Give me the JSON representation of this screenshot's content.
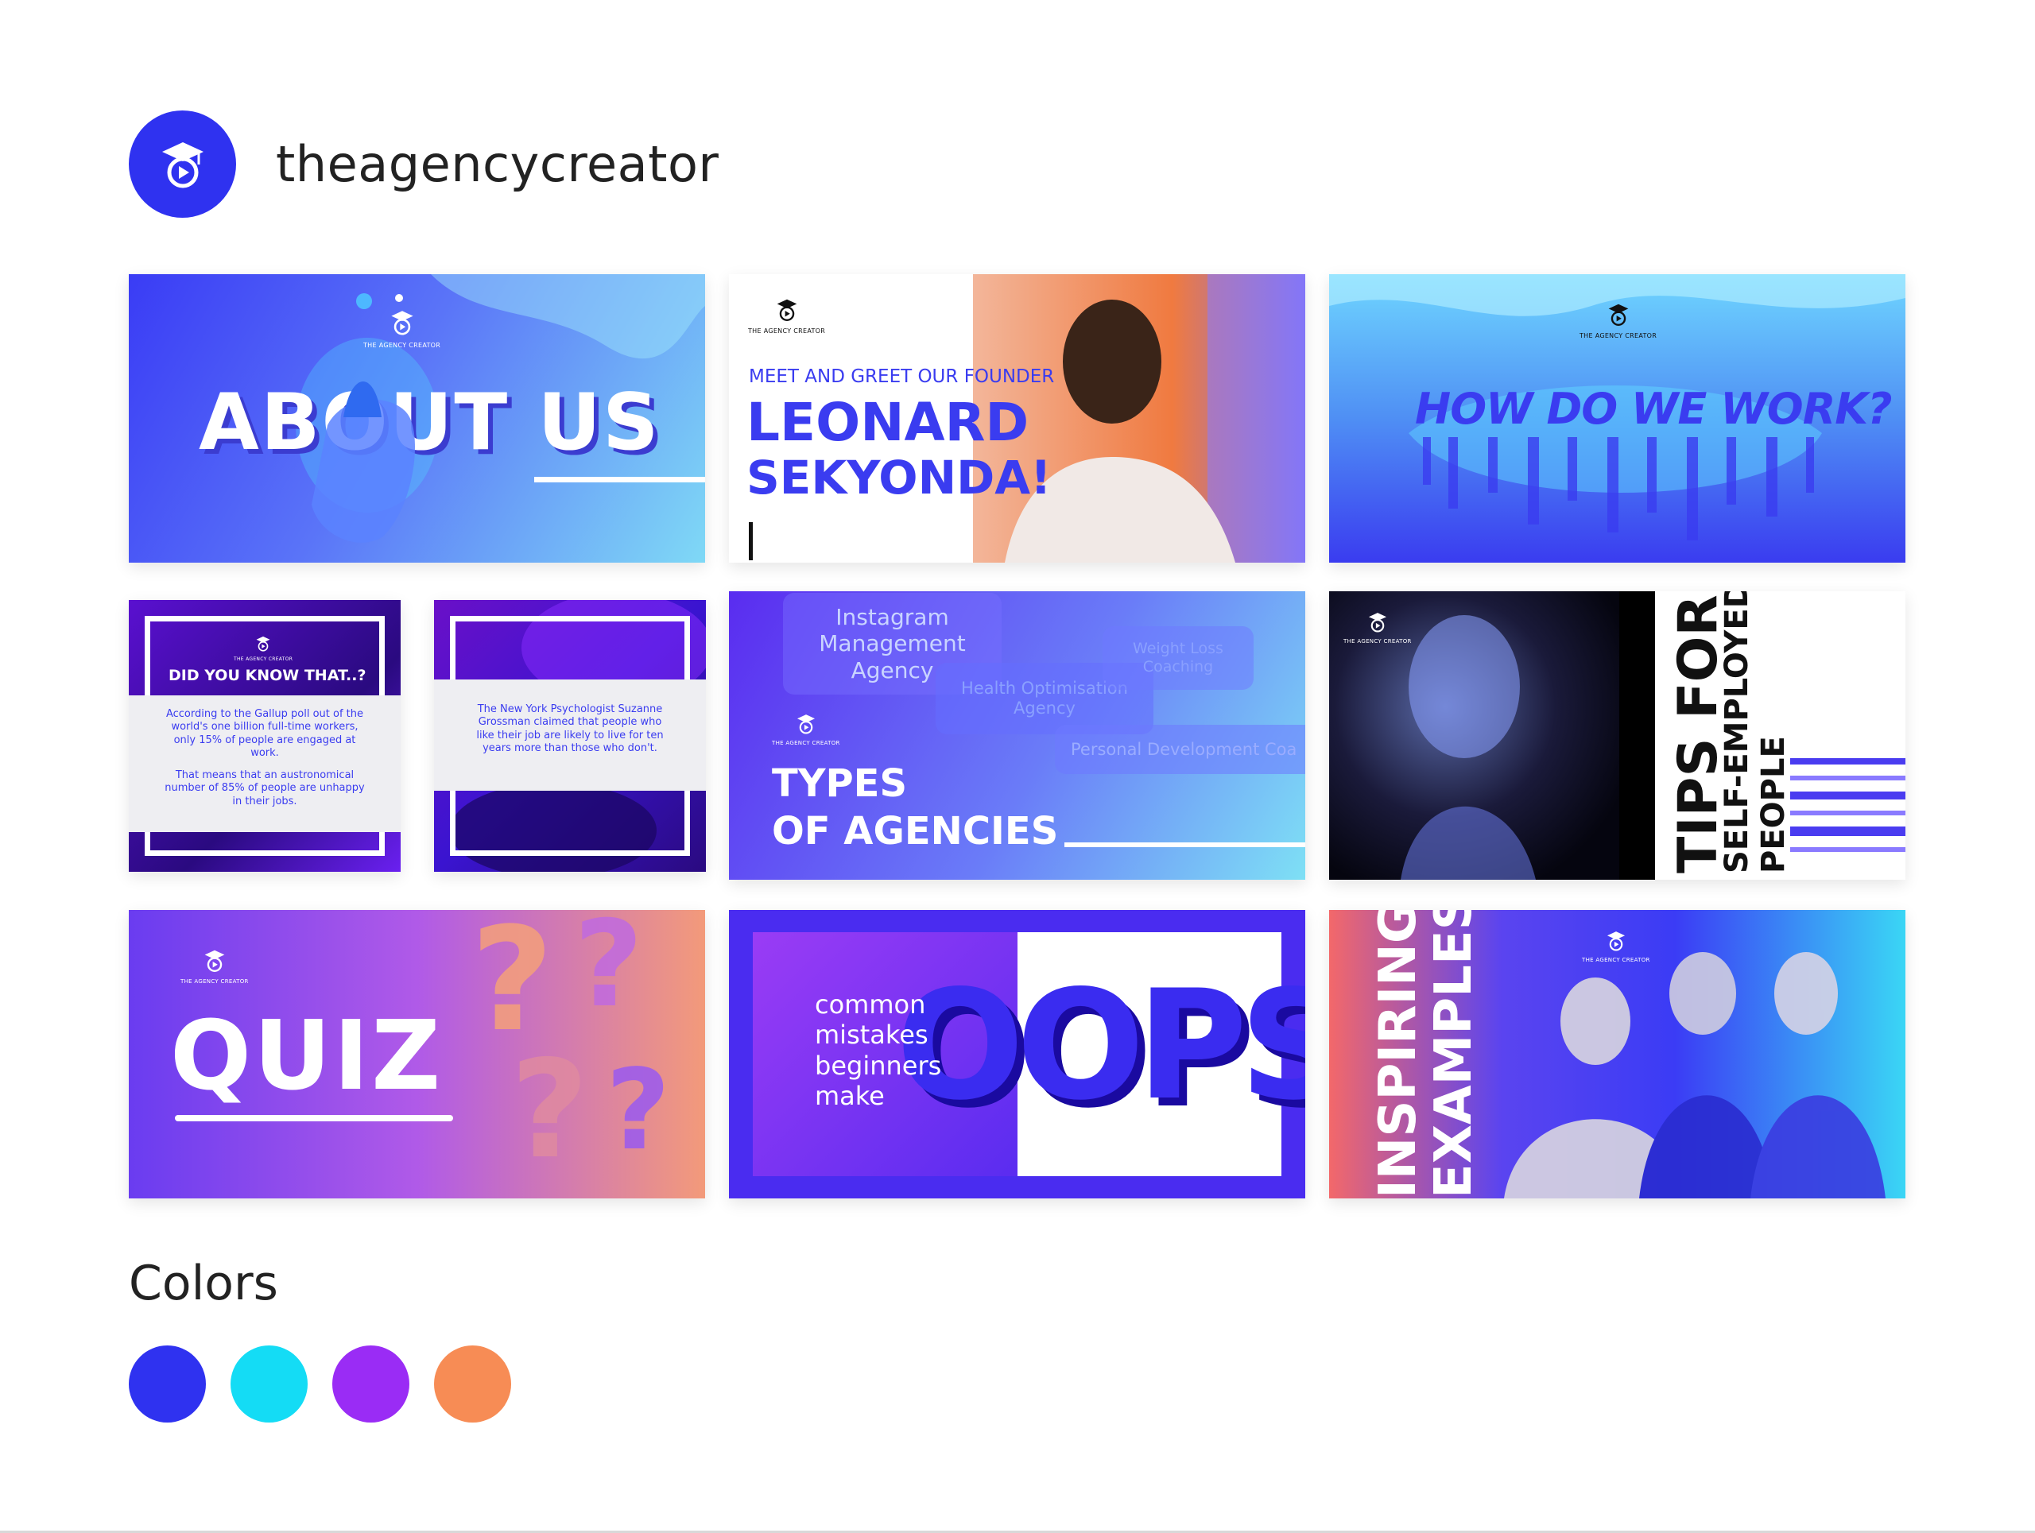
{
  "header": {
    "brand_name": "theagencycreator",
    "logo_icon": "graduation-cap-play-icon"
  },
  "logo_caption": "THE AGENCY CREATOR",
  "cards": {
    "about": {
      "title": "ABOUT US"
    },
    "leonard": {
      "kicker": "MEET AND GREET OUR FOUNDER",
      "line1": "LEONARD",
      "line2": "SEKYONDA!"
    },
    "how": {
      "title": "HOW DO WE WORK?"
    },
    "did": {
      "title": "DID YOU KNOW THAT..?",
      "p1": "According to the Gallup poll out of the world's one billion full-time workers, only 15% of people are engaged at work.",
      "p2": "That means that an austronomical number of 85% of people are unhappy in their jobs."
    },
    "ny": {
      "p1": "The New York Psychologist Suzanne Grossman claimed that people who like their job are likely to live for ten years more than those who don't."
    },
    "types": {
      "line1": "TYPES",
      "line2": "OF AGENCIES",
      "bubbles": [
        "Instagram Management Agency",
        "Health Optimisation Agency",
        "Weight Loss Coaching",
        "Personal Development Coa"
      ]
    },
    "tips": {
      "line1": "TIPS FOR",
      "line2": "SELF-EMPLOYED",
      "line3": "PEOPLE"
    },
    "quiz": {
      "title": "QUIZ"
    },
    "oops": {
      "script": "common mistakes beginners make",
      "big": "OOPS!"
    },
    "inspiring": {
      "line1": "INSPIRING",
      "line2": "EXAMPLES"
    }
  },
  "colors_section": {
    "title": "Colors",
    "swatches": [
      "#2f32f0",
      "#14dcf5",
      "#9a2cf5",
      "#f78c55"
    ]
  }
}
